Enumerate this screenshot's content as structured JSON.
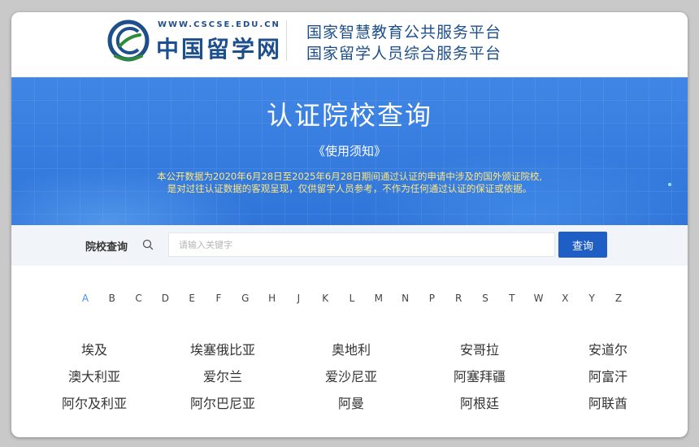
{
  "header": {
    "logo_url_text": "WWW.CSCSE.EDU.CN",
    "logo_name": "中国留学网",
    "line1": "国家智慧教育公共服务平台",
    "line2": "国家留学人员综合服务平台"
  },
  "banner": {
    "title": "认证院校查询",
    "notice_link": "《使用须知》",
    "description_line1": "本公开数据为2020年6月28日至2025年6月28日期间通过认证的申请中涉及的国外颁证院校,",
    "description_line2": "是对过往认证数据的客观呈现，仅供留学人员参考，不作为任何通过认证的保证或依据。"
  },
  "search": {
    "label": "院校查询",
    "placeholder": "请输入关键字",
    "value": "",
    "button_label": "查询"
  },
  "alphabet": {
    "active": "A",
    "letters": [
      "A",
      "B",
      "C",
      "D",
      "E",
      "F",
      "G",
      "H",
      "J",
      "K",
      "L",
      "M",
      "N",
      "P",
      "R",
      "S",
      "T",
      "W",
      "X",
      "Y",
      "Z"
    ]
  },
  "countries": [
    [
      "埃及",
      "埃塞俄比亚",
      "奥地利",
      "安哥拉",
      "安道尔"
    ],
    [
      "澳大利亚",
      "爱尔兰",
      "爱沙尼亚",
      "阿塞拜疆",
      "阿富汗"
    ],
    [
      "阿尔及利亚",
      "阿尔巴尼亚",
      "阿曼",
      "阿根廷",
      "阿联酋"
    ]
  ],
  "colors": {
    "brand_blue": "#1d4f8c",
    "banner_blue": "#3a80e0",
    "button_blue": "#1f5fc5",
    "active_letter": "#4a90e2",
    "notice_yellow": "#ffe680"
  },
  "icons": {
    "logo": "cscse-logo-icon",
    "search": "search-icon"
  }
}
